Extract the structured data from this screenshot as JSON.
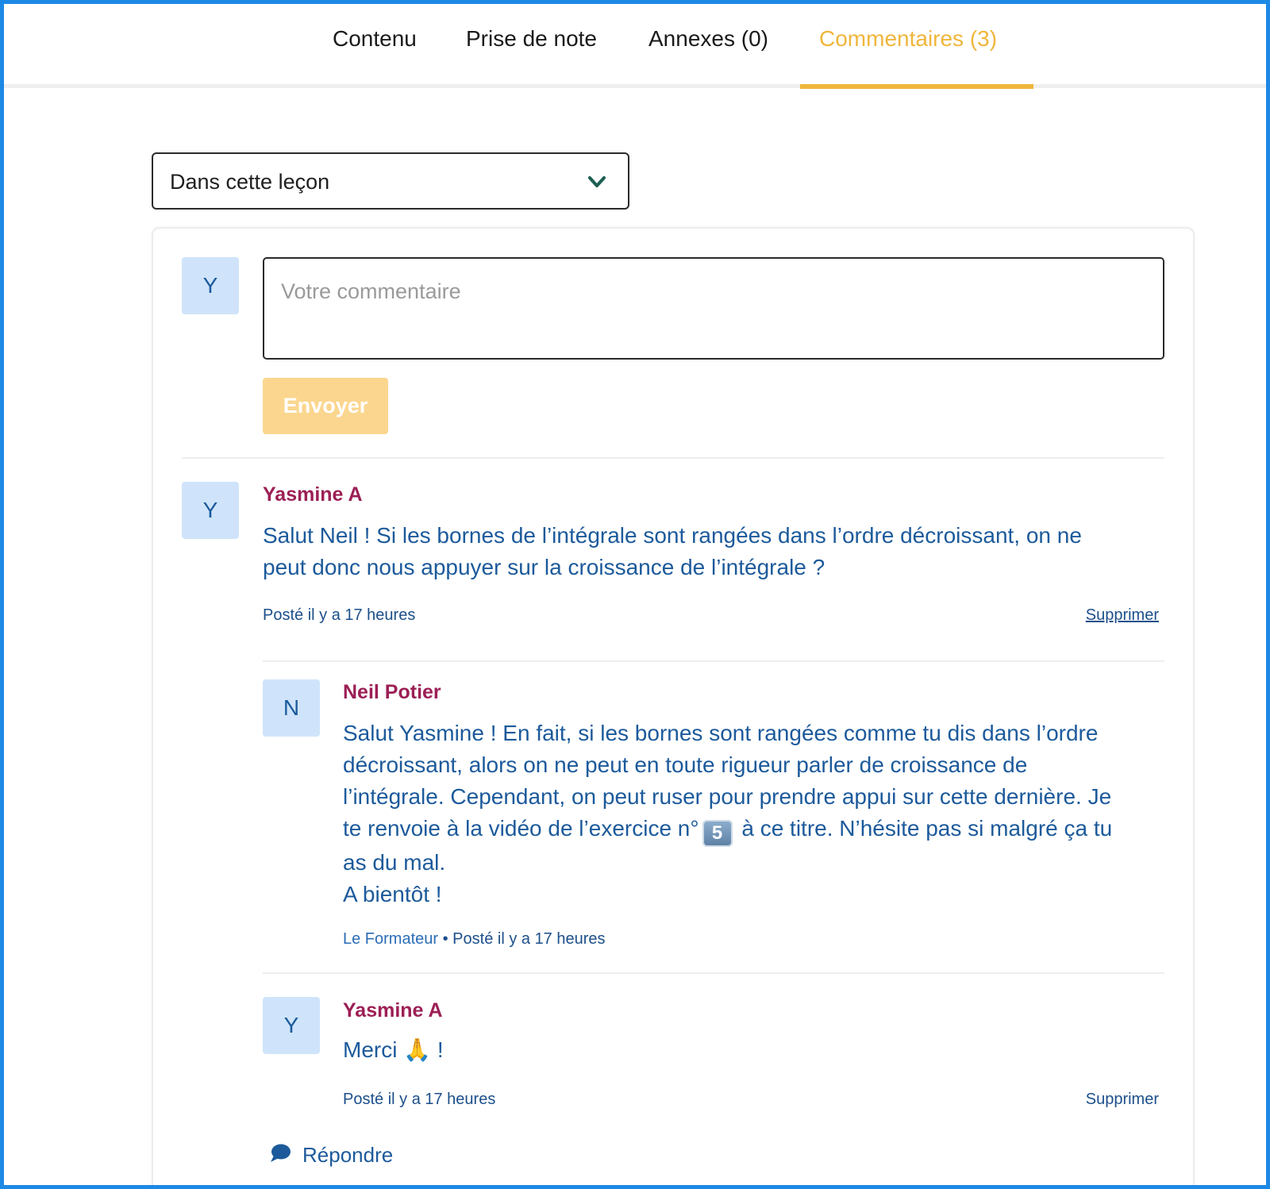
{
  "tabs": [
    {
      "label": "Contenu",
      "active": false
    },
    {
      "label": "Prise de note",
      "active": false
    },
    {
      "label": "Annexes (0)",
      "active": false
    },
    {
      "label": "Commentaires (3)",
      "active": true
    }
  ],
  "filter": {
    "selected": "Dans cette leçon",
    "icon": "chevron-down-icon"
  },
  "composer": {
    "avatar_letter": "Y",
    "placeholder": "Votre commentaire",
    "value": "",
    "send_label": "Envoyer"
  },
  "comments": [
    {
      "avatar_letter": "Y",
      "author": "Yasmine A",
      "body_line1": "Salut Neil ! Si les bornes de l’intégrale sont rangées dans l’ordre décroissant, on ne",
      "body_line2": "peut donc nous appuyer sur la croissance de l’intégrale ?",
      "meta": "Posté il y a 17 heures",
      "delete_label": "Supprimer"
    },
    {
      "avatar_letter": "N",
      "author": "Neil Potier",
      "body_line1": "Salut Yasmine ! En fait, si les bornes sont rangées comme tu dis dans l’ordre",
      "body_line2": "décroissant, alors on ne peut en toute rigueur parler de croissance de",
      "body_line3": "l’intégrale. Cependant, on peut ruser pour prendre appui sur cette dernière. Je",
      "body_line4_before": "te renvoie à la vidéo de l’exercice n°",
      "body_line4_keycap": "5",
      "body_line4_after": " à ce titre. N’hésite pas si malgré ça tu",
      "body_line5": "as du mal.",
      "body_line6": "A bientôt !",
      "role": "Le Formateur",
      "meta": "• Posté il y a 17 heures"
    },
    {
      "avatar_letter": "Y",
      "author": "Yasmine A",
      "body_before": "Merci ",
      "emoji": "🙏",
      "body_after": " !",
      "meta": "Posté il y a 17 heures",
      "delete_label": "Supprimer"
    }
  ],
  "reply_label": "Répondre",
  "colors": {
    "accent": "#f0b63c",
    "author": "#9c1f55",
    "text_blue": "#1c5a9b",
    "avatar_bg": "#cfe4fa",
    "frame": "#1e88e5"
  }
}
